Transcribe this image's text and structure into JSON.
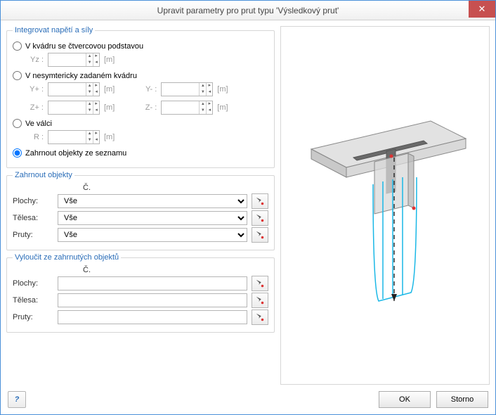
{
  "window": {
    "title": "Upravit parametry pro prut typu 'Výsledkový prut'"
  },
  "group_integrate": {
    "legend": "Integrovat napětí a síly",
    "opt_square": "V kvádru se čtvercovou podstavou",
    "lbl_yz": "Yz :",
    "unit": "[m]",
    "opt_asym": "V nesymtericky zadaném kvádru",
    "lbl_yp": "Y+ :",
    "lbl_ym": "Y- :",
    "lbl_zp": "Z+ :",
    "lbl_zm": "Z- :",
    "opt_cyl": "Ve válci",
    "lbl_r": "R :",
    "opt_list": "Zahrnout objekty ze seznamu"
  },
  "group_include": {
    "legend": "Zahrnout objekty",
    "col_header": "Č.",
    "row_surfaces": "Plochy:",
    "row_solids": "Tělesa:",
    "row_members": "Pruty:",
    "val_all": "Vše"
  },
  "group_exclude": {
    "legend": "Vyloučit ze zahrnutých objektů",
    "col_header": "Č.",
    "row_surfaces": "Plochy:",
    "row_solids": "Tělesa:",
    "row_members": "Pruty:"
  },
  "footer": {
    "ok": "OK",
    "cancel": "Storno"
  }
}
